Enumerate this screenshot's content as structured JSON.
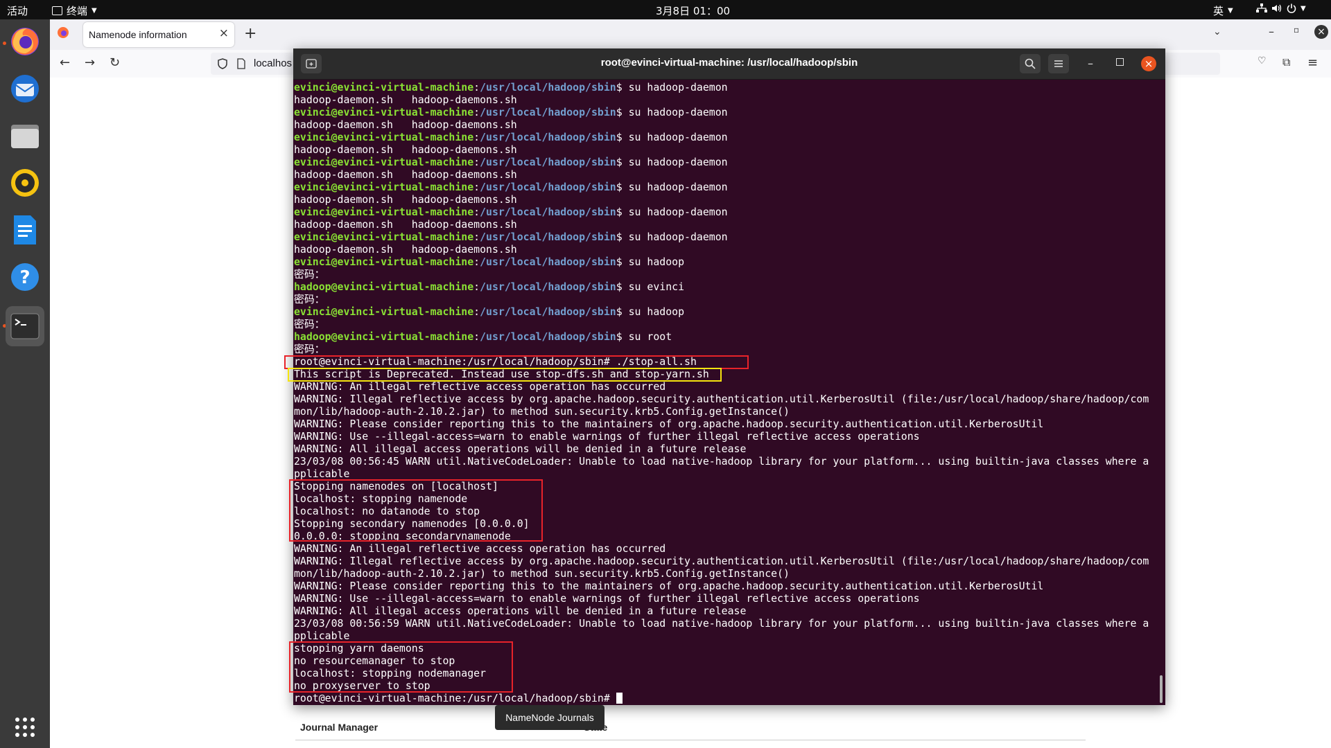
{
  "topbar": {
    "activities": "活动",
    "app_menu": "终端",
    "clock": "3月8日 01：00",
    "input_method": "英"
  },
  "browser": {
    "tab_title": "Namenode information",
    "url": "localhos"
  },
  "terminal": {
    "title": "root@evinci-virtual-machine: /usr/local/hadoop/sbin",
    "lines": [
      {
        "u": "evinci@evinci-virtual-machine",
        "p": "/usr/local/hadoop/sbin",
        "c": "$ su hadoop-daemon"
      },
      {
        "t": "hadoop-daemon.sh   hadoop-daemons.sh"
      },
      {
        "u": "evinci@evinci-virtual-machine",
        "p": "/usr/local/hadoop/sbin",
        "c": "$ su hadoop-daemon"
      },
      {
        "t": "hadoop-daemon.sh   hadoop-daemons.sh"
      },
      {
        "u": "evinci@evinci-virtual-machine",
        "p": "/usr/local/hadoop/sbin",
        "c": "$ su hadoop-daemon"
      },
      {
        "t": "hadoop-daemon.sh   hadoop-daemons.sh"
      },
      {
        "u": "evinci@evinci-virtual-machine",
        "p": "/usr/local/hadoop/sbin",
        "c": "$ su hadoop-daemon"
      },
      {
        "t": "hadoop-daemon.sh   hadoop-daemons.sh"
      },
      {
        "u": "evinci@evinci-virtual-machine",
        "p": "/usr/local/hadoop/sbin",
        "c": "$ su hadoop-daemon"
      },
      {
        "t": "hadoop-daemon.sh   hadoop-daemons.sh"
      },
      {
        "u": "evinci@evinci-virtual-machine",
        "p": "/usr/local/hadoop/sbin",
        "c": "$ su hadoop-daemon"
      },
      {
        "t": "hadoop-daemon.sh   hadoop-daemons.sh"
      },
      {
        "u": "evinci@evinci-virtual-machine",
        "p": "/usr/local/hadoop/sbin",
        "c": "$ su hadoop-daemon"
      },
      {
        "t": "hadoop-daemon.sh   hadoop-daemons.sh"
      },
      {
        "u": "evinci@evinci-virtual-machine",
        "p": "/usr/local/hadoop/sbin",
        "c": "$ su hadoop"
      },
      {
        "t": "密码："
      },
      {
        "u": "hadoop@evinci-virtual-machine",
        "p": "/usr/local/hadoop/sbin",
        "c": "$ su evinci"
      },
      {
        "t": "密码："
      },
      {
        "u": "evinci@evinci-virtual-machine",
        "p": "/usr/local/hadoop/sbin",
        "c": "$ su hadoop"
      },
      {
        "t": "密码："
      },
      {
        "u": "hadoop@evinci-virtual-machine",
        "p": "/usr/local/hadoop/sbin",
        "c": "$ su root"
      },
      {
        "t": "密码："
      },
      {
        "t": "root@evinci-virtual-machine:/usr/local/hadoop/sbin# ./stop-all.sh"
      },
      {
        "t": "This script is Deprecated. Instead use stop-dfs.sh and stop-yarn.sh"
      },
      {
        "t": "WARNING: An illegal reflective access operation has occurred"
      },
      {
        "t": "WARNING: Illegal reflective access by org.apache.hadoop.security.authentication.util.KerberosUtil (file:/usr/local/hadoop/share/hadoop/com"
      },
      {
        "t": "mon/lib/hadoop-auth-2.10.2.jar) to method sun.security.krb5.Config.getInstance()"
      },
      {
        "t": "WARNING: Please consider reporting this to the maintainers of org.apache.hadoop.security.authentication.util.KerberosUtil"
      },
      {
        "t": "WARNING: Use --illegal-access=warn to enable warnings of further illegal reflective access operations"
      },
      {
        "t": "WARNING: All illegal access operations will be denied in a future release"
      },
      {
        "t": "23/03/08 00:56:45 WARN util.NativeCodeLoader: Unable to load native-hadoop library for your platform... using builtin-java classes where a"
      },
      {
        "t": "pplicable"
      },
      {
        "t": "Stopping namenodes on [localhost]"
      },
      {
        "t": "localhost: stopping namenode"
      },
      {
        "t": "localhost: no datanode to stop"
      },
      {
        "t": "Stopping secondary namenodes [0.0.0.0]"
      },
      {
        "t": "0.0.0.0: stopping secondarynamenode"
      },
      {
        "t": "WARNING: An illegal reflective access operation has occurred"
      },
      {
        "t": "WARNING: Illegal reflective access by org.apache.hadoop.security.authentication.util.KerberosUtil (file:/usr/local/hadoop/share/hadoop/com"
      },
      {
        "t": "mon/lib/hadoop-auth-2.10.2.jar) to method sun.security.krb5.Config.getInstance()"
      },
      {
        "t": "WARNING: Please consider reporting this to the maintainers of org.apache.hadoop.security.authentication.util.KerberosUtil"
      },
      {
        "t": "WARNING: Use --illegal-access=warn to enable warnings of further illegal reflective access operations"
      },
      {
        "t": "WARNING: All illegal access operations will be denied in a future release"
      },
      {
        "t": "23/03/08 00:56:59 WARN util.NativeCodeLoader: Unable to load native-hadoop library for your platform... using builtin-java classes where a"
      },
      {
        "t": "pplicable"
      },
      {
        "t": "stopping yarn daemons"
      },
      {
        "t": "no resourcemanager to stop"
      },
      {
        "t": "localhost: stopping nodemanager"
      },
      {
        "t": "no proxyserver to stop"
      }
    ],
    "prompt": "root@evinci-virtual-machine:/usr/local/hadoop/sbin# "
  },
  "page": {
    "journal_heading": "Journal Manager",
    "state_heading": "State",
    "tooltip": "NameNode Journals"
  },
  "colors": {
    "terminal_bg": "#300a24",
    "user_green": "#8ae234",
    "path_blue": "#729fcf",
    "highlight_red": "#e8232a",
    "highlight_yellow": "#f5e50f"
  }
}
